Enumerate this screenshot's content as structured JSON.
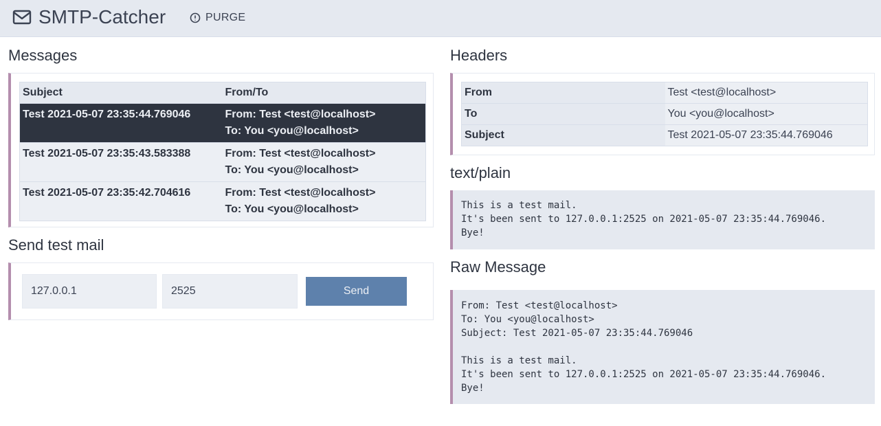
{
  "app": {
    "title": "SMTP-Catcher",
    "purge_label": "PURGE"
  },
  "colors": {
    "accent": "#b48ead",
    "selected_row": "#2e3440",
    "button": "#5e81ac",
    "panel_bg": "#e5e9f0"
  },
  "messages": {
    "title": "Messages",
    "columns": {
      "subject": "Subject",
      "fromto": "From/To"
    },
    "rows": [
      {
        "subject": "Test 2021-05-07 23:35:44.769046",
        "from": "From: Test <test@localhost>",
        "to": "To: You <you@localhost>",
        "selected": true
      },
      {
        "subject": "Test 2021-05-07 23:35:43.583388",
        "from": "From: Test <test@localhost>",
        "to": "To: You <you@localhost>",
        "selected": false
      },
      {
        "subject": "Test 2021-05-07 23:35:42.704616",
        "from": "From: Test <test@localhost>",
        "to": "To: You <you@localhost>",
        "selected": false
      }
    ]
  },
  "send_test": {
    "title": "Send test mail",
    "host_value": "127.0.0.1",
    "port_value": "2525",
    "send_label": "Send"
  },
  "headers": {
    "title": "Headers",
    "rows": [
      {
        "key": "From",
        "value": "Test <test@localhost>"
      },
      {
        "key": "To",
        "value": "You <you@localhost>"
      },
      {
        "key": "Subject",
        "value": "Test 2021-05-07 23:35:44.769046"
      }
    ]
  },
  "text_plain": {
    "title": "text/plain",
    "body": "This is a test mail.\nIt's been sent to 127.0.0.1:2525 on 2021-05-07 23:35:44.769046.\nBye!"
  },
  "raw_message": {
    "title": "Raw Message",
    "body": "From: Test <test@localhost>\nTo: You <you@localhost>\nSubject: Test 2021-05-07 23:35:44.769046\n\nThis is a test mail.\nIt's been sent to 127.0.0.1:2525 on 2021-05-07 23:35:44.769046.\nBye!"
  },
  "icons": {
    "brand": "mail-icon",
    "purge": "alert-circle-icon"
  }
}
